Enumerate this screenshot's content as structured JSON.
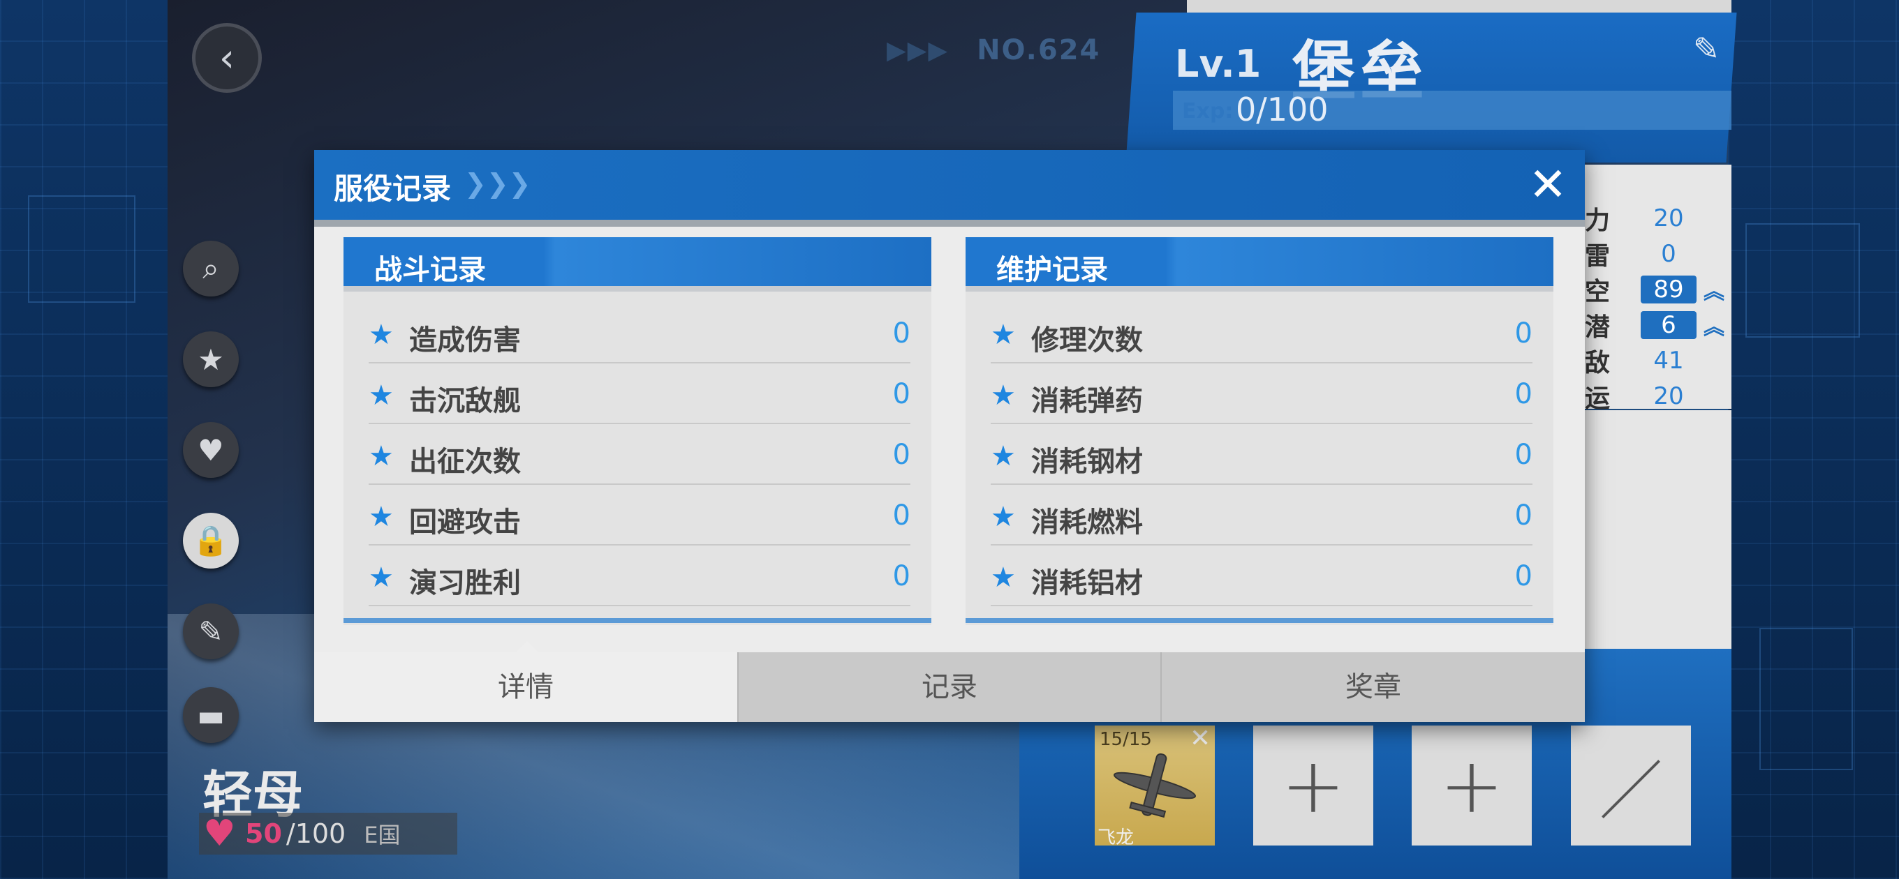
{
  "ship": {
    "number": "NO.624",
    "level": "Lv.1",
    "name": "堡垒",
    "exp_label": "Exp:",
    "exp_value": "0/100",
    "type": "轻母",
    "affection_current": "50",
    "affection_max": "/100",
    "nation": "E国"
  },
  "stats": [
    {
      "label": "力",
      "value": "20",
      "boxed": false,
      "upgradable": false
    },
    {
      "label": "雷",
      "value": "0",
      "boxed": false,
      "upgradable": false
    },
    {
      "label": "空",
      "value": "89",
      "boxed": true,
      "upgradable": true
    },
    {
      "label": "潜",
      "value": "6",
      "boxed": true,
      "upgradable": true
    },
    {
      "label": "敌",
      "value": "41",
      "boxed": false,
      "upgradable": false
    },
    {
      "label": "运",
      "value": "20",
      "boxed": false,
      "upgradable": false
    }
  ],
  "equipment": {
    "plane_count": "15/15",
    "plane_name": "飞龙"
  },
  "modal": {
    "title": "服役记录",
    "title_arrows": "❯❯❯",
    "battle": {
      "title": "战斗记录",
      "rows": [
        {
          "label": "造成伤害",
          "value": "0"
        },
        {
          "label": "击沉敌舰",
          "value": "0"
        },
        {
          "label": "出征次数",
          "value": "0"
        },
        {
          "label": "回避攻击",
          "value": "0"
        },
        {
          "label": "演习胜利",
          "value": "0"
        }
      ]
    },
    "maintenance": {
      "title": "维护记录",
      "rows": [
        {
          "label": "修理次数",
          "value": "0"
        },
        {
          "label": "消耗弹药",
          "value": "0"
        },
        {
          "label": "消耗钢材",
          "value": "0"
        },
        {
          "label": "消耗燃料",
          "value": "0"
        },
        {
          "label": "消耗铝材",
          "value": "0"
        }
      ]
    },
    "tabs": [
      "详情",
      "记录",
      "奖章"
    ],
    "active_tab": "详情"
  },
  "colors": {
    "accent_blue": "#1b6fc2",
    "value_blue": "#2f98e6",
    "heart_pink": "#e2457a"
  }
}
